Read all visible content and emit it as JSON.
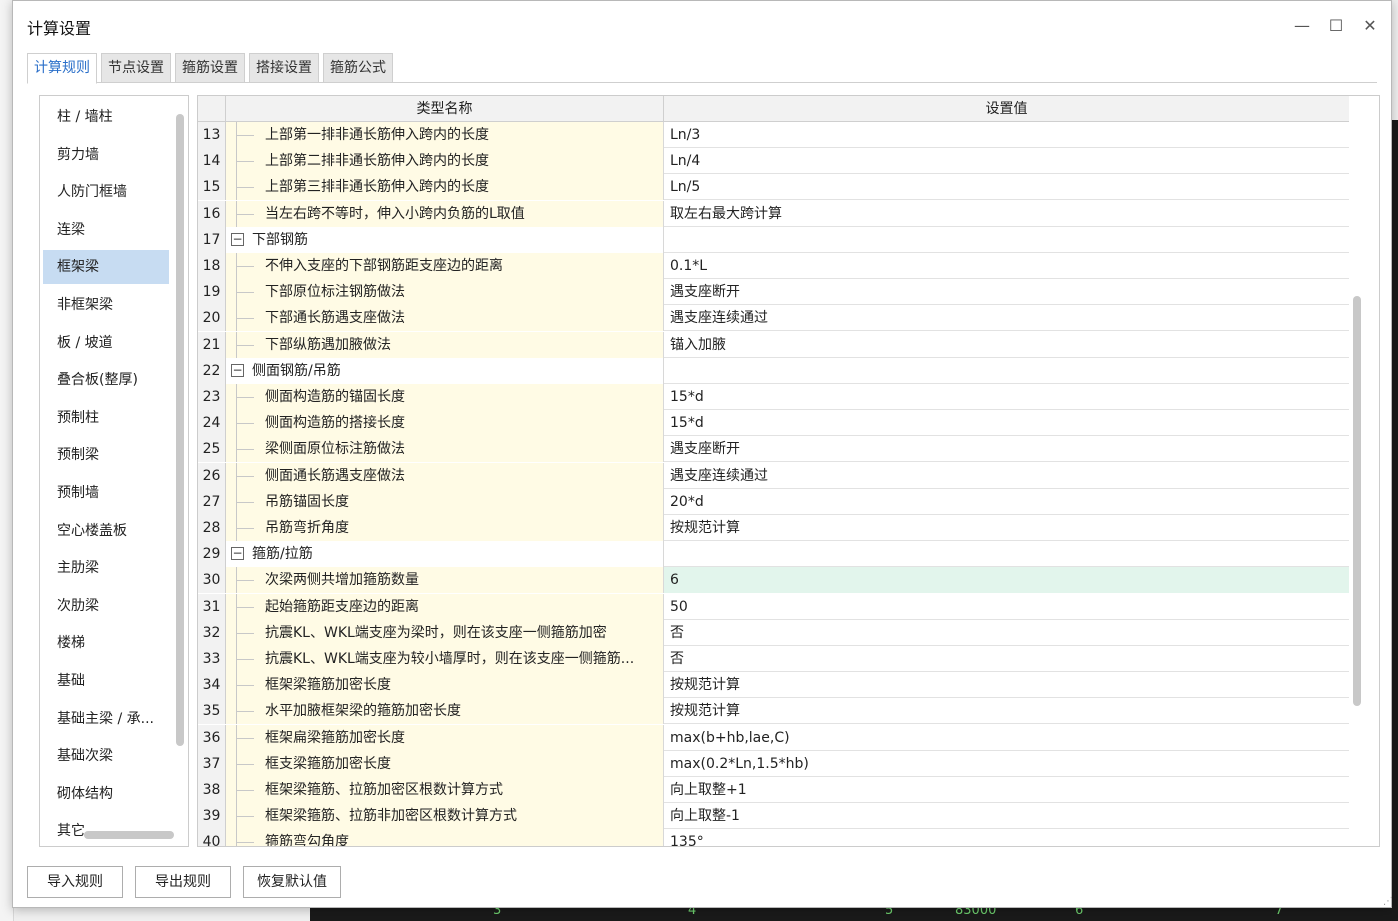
{
  "dialog": {
    "title": "计算设置",
    "minimize_glyph": "—",
    "maximize_glyph": "☐",
    "close_glyph": "✕"
  },
  "tabs": [
    {
      "label": "计算规则",
      "active": true
    },
    {
      "label": "节点设置"
    },
    {
      "label": "箍筋设置"
    },
    {
      "label": "搭接设置"
    },
    {
      "label": "箍筋公式"
    }
  ],
  "categories": [
    "柱 / 墙柱",
    "剪力墙",
    "人防门框墙",
    "连梁",
    "框架梁",
    "非框架梁",
    "板 / 坡道",
    "叠合板(整厚)",
    "预制柱",
    "预制梁",
    "预制墙",
    "空心楼盖板",
    "主肋梁",
    "次肋梁",
    "楼梯",
    "基础",
    "基础主梁 / 承...",
    "基础次梁",
    "砌体结构",
    "其它"
  ],
  "selected_category": "框架梁",
  "grid": {
    "col_name": "类型名称",
    "col_value": "设置值",
    "rows": [
      {
        "num": "13",
        "name": "上部第一排非通长筋伸入跨内的长度",
        "value": "Ln/3"
      },
      {
        "num": "14",
        "name": "上部第二排非通长筋伸入跨内的长度",
        "value": "Ln/4"
      },
      {
        "num": "15",
        "name": "上部第三排非通长筋伸入跨内的长度",
        "value": "Ln/5"
      },
      {
        "num": "16",
        "name": "当左右跨不等时，伸入小跨内负筋的L取值",
        "value": "取左右最大跨计算"
      },
      {
        "num": "17",
        "name": "下部钢筋",
        "value": "",
        "group": true
      },
      {
        "num": "18",
        "name": "不伸入支座的下部钢筋距支座边的距离",
        "value": "0.1*L"
      },
      {
        "num": "19",
        "name": "下部原位标注钢筋做法",
        "value": "遇支座断开"
      },
      {
        "num": "20",
        "name": "下部通长筋遇支座做法",
        "value": "遇支座连续通过"
      },
      {
        "num": "21",
        "name": "下部纵筋遇加腋做法",
        "value": "锚入加腋"
      },
      {
        "num": "22",
        "name": "侧面钢筋/吊筋",
        "value": "",
        "group": true
      },
      {
        "num": "23",
        "name": "侧面构造筋的锚固长度",
        "value": "15*d"
      },
      {
        "num": "24",
        "name": "侧面构造筋的搭接长度",
        "value": "15*d"
      },
      {
        "num": "25",
        "name": "梁侧面原位标注筋做法",
        "value": "遇支座断开"
      },
      {
        "num": "26",
        "name": "侧面通长筋遇支座做法",
        "value": "遇支座连续通过"
      },
      {
        "num": "27",
        "name": "吊筋锚固长度",
        "value": "20*d"
      },
      {
        "num": "28",
        "name": "吊筋弯折角度",
        "value": "按规范计算"
      },
      {
        "num": "29",
        "name": "箍筋/拉筋",
        "value": "",
        "group": true
      },
      {
        "num": "30",
        "name": "次梁两侧共增加箍筋数量",
        "value": "6",
        "highlight": true
      },
      {
        "num": "31",
        "name": "起始箍筋距支座边的距离",
        "value": "50"
      },
      {
        "num": "32",
        "name": "抗震KL、WKL端支座为梁时，则在该支座一侧箍筋加密",
        "value": "否"
      },
      {
        "num": "33",
        "name": "抗震KL、WKL端支座为较小墙厚时，则在该支座一侧箍筋...",
        "value": "否"
      },
      {
        "num": "34",
        "name": "框架梁箍筋加密长度",
        "value": "按规范计算"
      },
      {
        "num": "35",
        "name": "水平加腋框架梁的箍筋加密长度",
        "value": "按规范计算"
      },
      {
        "num": "36",
        "name": "框架扁梁箍筋加密长度",
        "value": "max(b+hb,lae,C)"
      },
      {
        "num": "37",
        "name": "框支梁箍筋加密长度",
        "value": "max(0.2*Ln,1.5*hb)"
      },
      {
        "num": "38",
        "name": "框架梁箍筋、拉筋加密区根数计算方式",
        "value": "向上取整+1"
      },
      {
        "num": "39",
        "name": "框架梁箍筋、拉筋非加密区根数计算方式",
        "value": "向上取整-1"
      },
      {
        "num": "40",
        "name": "箍筋弯勾角度",
        "value": "135°"
      }
    ]
  },
  "buttons": {
    "import": "导入规则",
    "export": "导出规则",
    "restore": "恢复默认值"
  },
  "background_axis_labels": [
    "3",
    "4",
    "5",
    "83000",
    "6",
    "7"
  ]
}
